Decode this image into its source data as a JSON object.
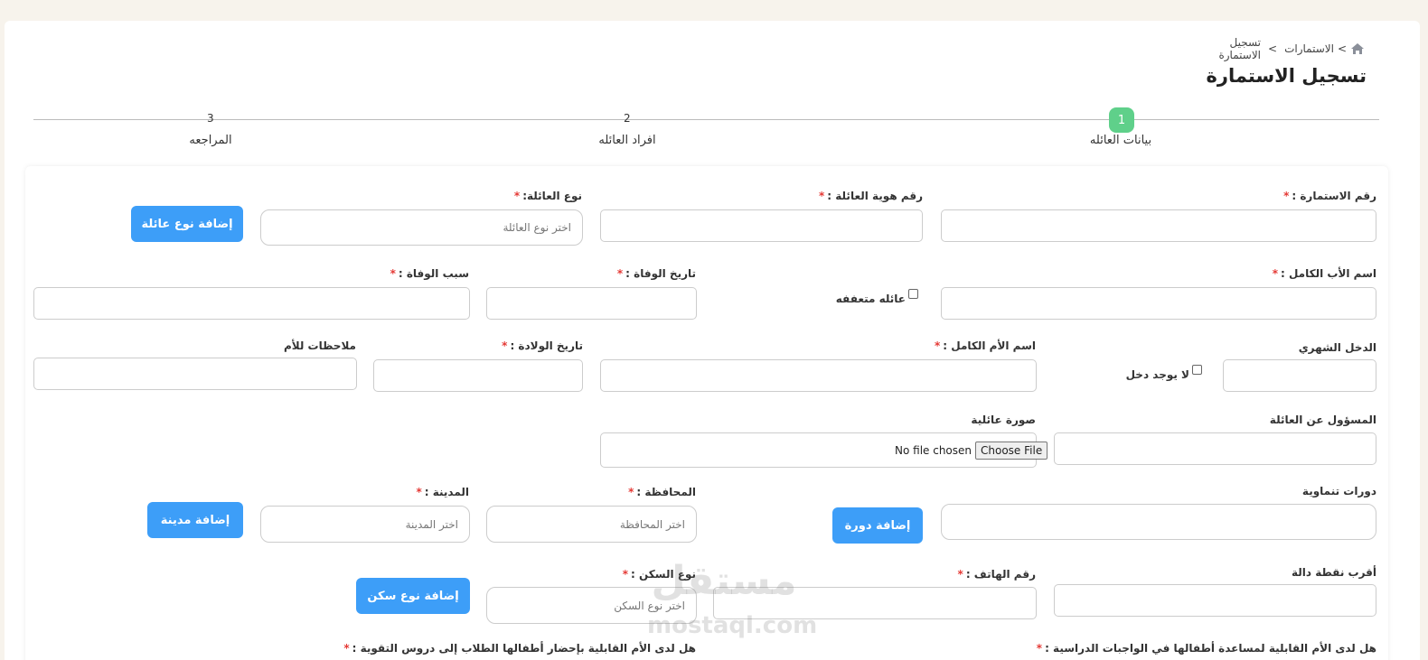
{
  "breadcrumb": {
    "current": "تسجيل الاستمارة",
    "parent": "الاستمارات",
    "separator": ">"
  },
  "page": {
    "title": "تسجيل الاستمارة"
  },
  "steps": [
    {
      "number": "1",
      "label": "بيانات العائله"
    },
    {
      "number": "2",
      "label": "افراد العائله"
    },
    {
      "number": "3",
      "label": "المراجعه"
    }
  ],
  "form": {
    "required_mark": "*",
    "form_number": {
      "label": "رقم الاستمارة :",
      "value": ""
    },
    "family_id": {
      "label": "رقم هوية العائلة :",
      "value": ""
    },
    "family_type": {
      "label": "نوع العائلة:",
      "placeholder": "اختر نوع العائلة"
    },
    "add_family_type": "إضافة نوع عائلة",
    "father_name": {
      "label": "اسم الأب الكامل :",
      "value": ""
    },
    "chaste_family": "عائله متعففه",
    "death_date": {
      "label": "تاريخ الوفاة :",
      "value": ""
    },
    "death_cause": {
      "label": "سبب الوفاة :",
      "value": ""
    },
    "monthly_income": {
      "label": "الدخل الشهري",
      "value": ""
    },
    "no_income": "لا يوجد دخل",
    "mother_name": {
      "label": "اسم الأم الكامل :",
      "value": ""
    },
    "birth_date": {
      "label": "تاريخ الولادة :",
      "value": ""
    },
    "mother_notes": {
      "label": "ملاحظات للأم",
      "value": ""
    },
    "responsible": {
      "label": "المسؤول عن العائلة",
      "value": ""
    },
    "family_photo": {
      "label": "صورة عائلية",
      "button": "Choose File",
      "status": "No file chosen"
    },
    "courses": {
      "label": "دورات تنماوية",
      "value": ""
    },
    "add_course": "إضافة دورة",
    "governorate": {
      "label": "المحافظة :",
      "placeholder": "اختر المحافظة"
    },
    "city": {
      "label": "المدينة :",
      "placeholder": "اختر المدينة"
    },
    "add_city": "إضافة مدينة",
    "landmark": {
      "label": "أقرب نقطة دالة",
      "value": ""
    },
    "phone": {
      "label": "رقم الهاتف :",
      "value": ""
    },
    "housing_type": {
      "label": "نوع السكن :",
      "placeholder": "اختر نوع السكن"
    },
    "add_housing_type": "إضافة نوع سكن",
    "q_homework": "هل لدى الأم القابلية لمساعدة أطفالها في الواجبات الدراسية :",
    "q_tutoring": "هل لدى الأم القابلية بإحضار أطفالها الطلاب إلى دروس التقوية :"
  },
  "watermark": {
    "arabic": "مستقل",
    "latin": "mostaql.com"
  },
  "colors": {
    "accent": "#3d9ef8",
    "step_active": "#5fd08a",
    "required": "#e53935",
    "page_bg": "#f7f3ec"
  }
}
